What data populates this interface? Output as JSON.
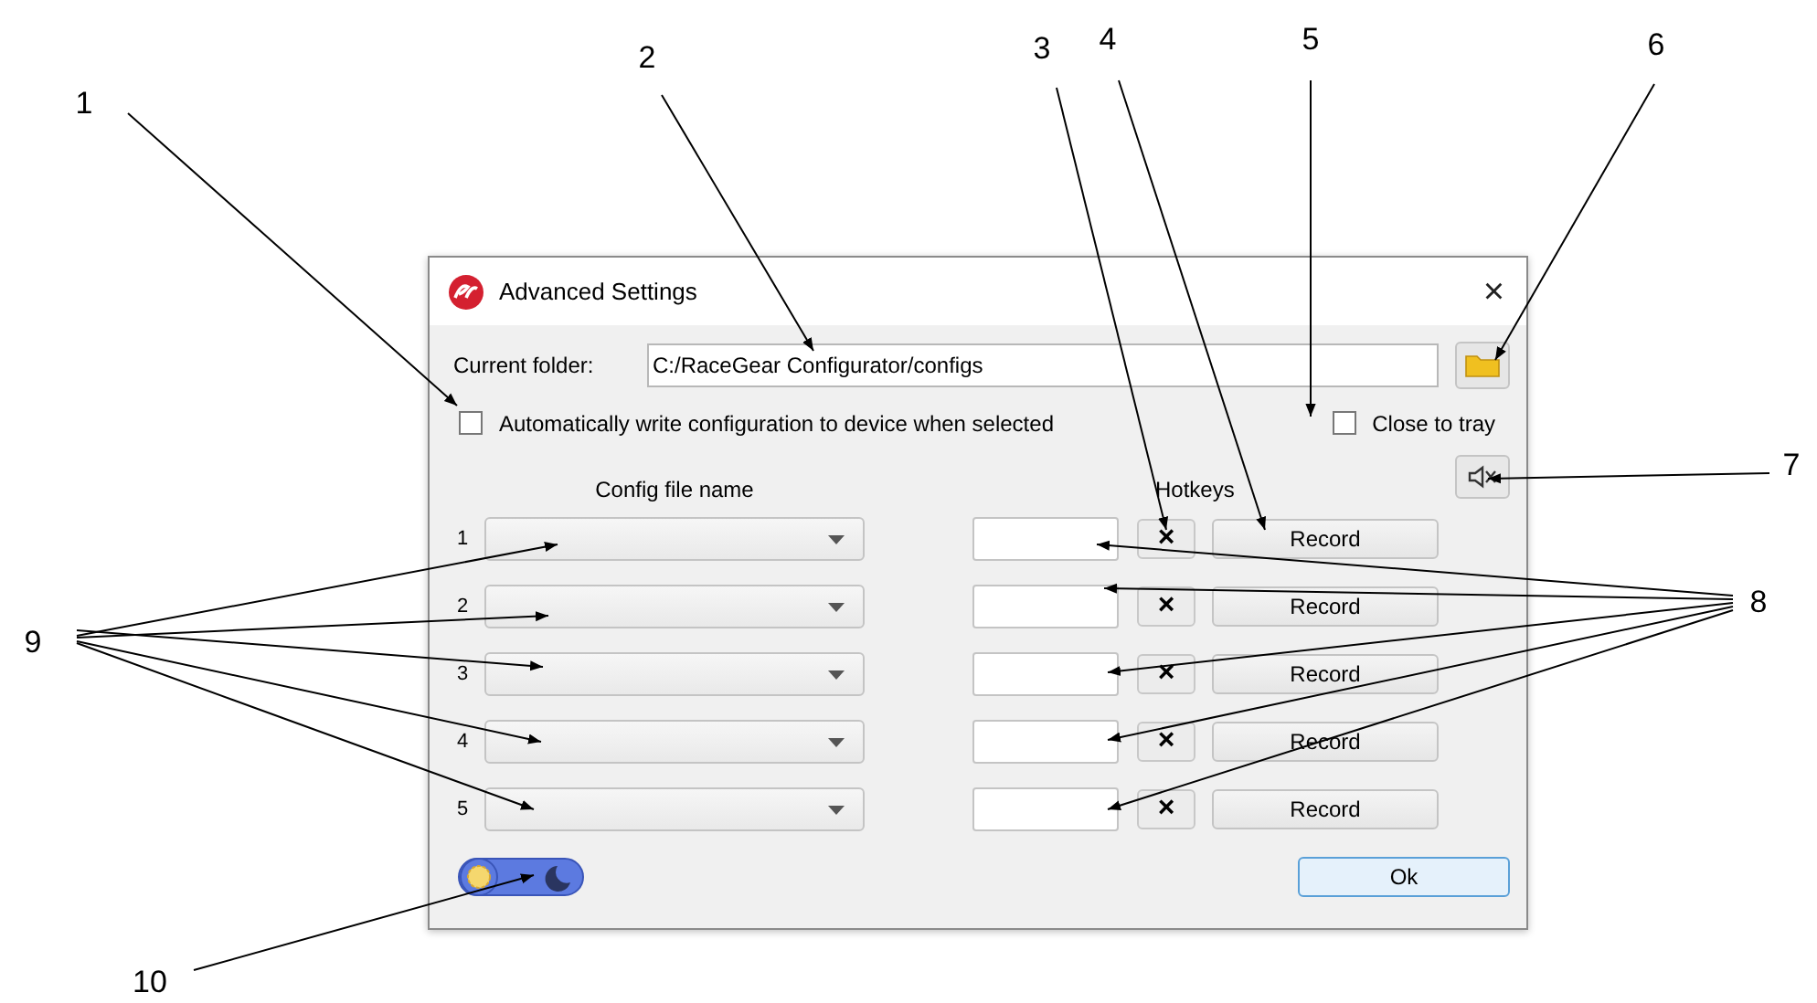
{
  "window": {
    "title": "Advanced Settings",
    "close": "×"
  },
  "folder": {
    "label": "Current folder:",
    "value": "C:/RaceGear Configurator/configs"
  },
  "auto_write": {
    "label": "Automatically write configuration to device when selected",
    "checked": false
  },
  "close_to_tray": {
    "label": "Close to tray",
    "checked": false
  },
  "headers": {
    "config": "Config file name",
    "hotkeys": "Hotkeys"
  },
  "rows": [
    {
      "number": "1",
      "clear": "×",
      "record": "Record"
    },
    {
      "number": "2",
      "clear": "×",
      "record": "Record"
    },
    {
      "number": "3",
      "clear": "×",
      "record": "Record"
    },
    {
      "number": "4",
      "clear": "×",
      "record": "Record"
    },
    {
      "number": "5",
      "clear": "×",
      "record": "Record"
    }
  ],
  "theme_toggle": {
    "dark": false
  },
  "ok": "Ok",
  "callouts": [
    "1",
    "2",
    "3",
    "4",
    "5",
    "6",
    "7",
    "8",
    "9",
    "10"
  ]
}
